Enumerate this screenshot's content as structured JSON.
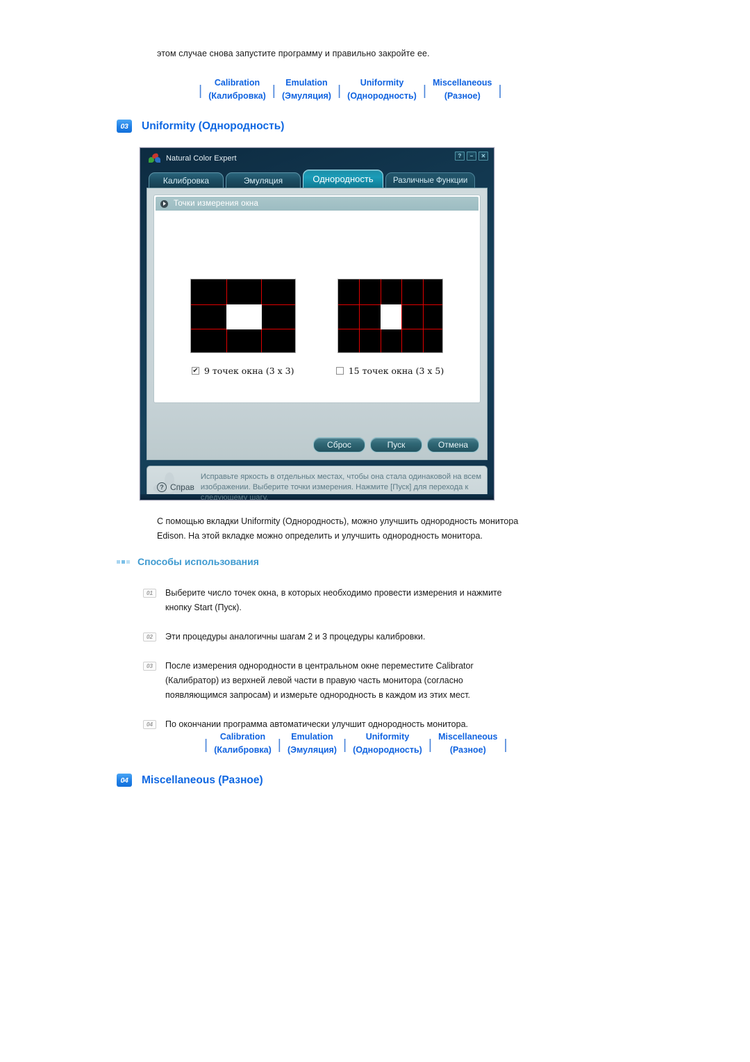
{
  "intro_text": "этом случае снова запустите программу и правильно закройте ее.",
  "nav": {
    "items": [
      {
        "en": "Calibration",
        "ru": "(Калибровка)"
      },
      {
        "en": "Emulation",
        "ru": "(Эмуляция)"
      },
      {
        "en": "Uniformity",
        "ru": "(Однородность)"
      },
      {
        "en": "Miscellaneous",
        "ru": "(Разное)"
      }
    ],
    "separator": "|"
  },
  "section_uniformity": {
    "number": "03",
    "title": "Uniformity (Однородность)"
  },
  "section_misc": {
    "number": "04",
    "title": "Miscellaneous (Разное)"
  },
  "app": {
    "title": "Natural Color Expert",
    "window_buttons": {
      "help": "?",
      "minimize": "–",
      "close": "✕"
    },
    "tabs": [
      {
        "label": "Калибровка",
        "state": "inactive"
      },
      {
        "label": "Эмуляция",
        "state": "inactive"
      },
      {
        "label": "Однородность",
        "state": "active"
      },
      {
        "label": "Различные Функции",
        "state": "plain"
      }
    ],
    "group_title": "Точки измерения окна",
    "options": [
      {
        "label": "9 точек окна (3 x 3)",
        "checked": true,
        "cols": 3,
        "rows": 3
      },
      {
        "label": "15 точек окна (3 x 5)",
        "checked": false,
        "cols": 5,
        "rows": 3
      }
    ],
    "buttons": [
      {
        "label": "Сброс"
      },
      {
        "label": "Пуск"
      },
      {
        "label": "Отмена"
      }
    ],
    "help": {
      "label": "Справ",
      "text": "Исправьте яркость в отдельных местах, чтобы она стала одинаковой на всем изображении. Выберите точки измерения. Нажмите [Пуск] для перехода к следующему шагу."
    },
    "colors": {
      "grid_line": "#e10000",
      "grid_bg": "#000000",
      "grid_cell": "#ffffff",
      "tab_active": "#1a9cb8",
      "window_bg": "#12374f"
    }
  },
  "body": {
    "paragraph_line1": "С помощью вкладки Uniformity (Однородность), можно улучшить однородность монитора",
    "paragraph_line2": "Edison. На этой вкладке можно определить и улучшить однородность монитора.",
    "howto_title": "Способы использования",
    "steps": [
      {
        "num": "01",
        "line1": "Выберите число точек окна, в которых необходимо провести измерения и нажмите",
        "line2": "кнопку Start (Пуск).",
        "line3": ""
      },
      {
        "num": "02",
        "line1": "Эти процедуры аналогичны шагам 2 и 3 процедуры калибровки.",
        "line2": "",
        "line3": ""
      },
      {
        "num": "03",
        "line1": "После измерения однородности в центральном окне переместите Calibrator",
        "line2": "(Калибратор) из верхней левой части в правую часть монитора (согласно",
        "line3": "появляющимся запросам) и измерьте однородность в каждом из этих мест."
      },
      {
        "num": "04",
        "line1": "По окончании программа автоматически улучшит однородность монитора.",
        "line2": "",
        "line3": ""
      }
    ]
  }
}
